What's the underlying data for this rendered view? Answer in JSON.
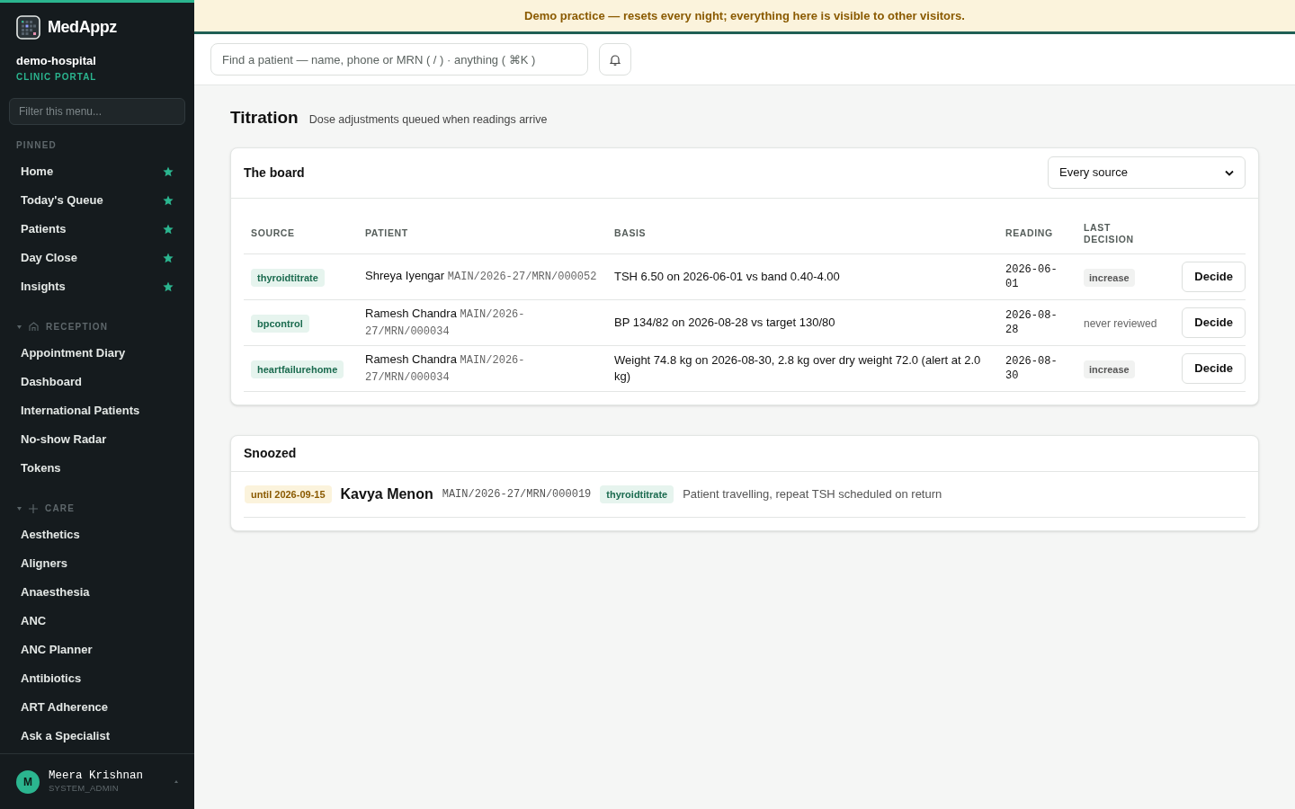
{
  "banner": "Demo practice — resets every night; everything here is visible to other visitors.",
  "sidebar": {
    "brand": "MedAppz",
    "org": "demo-hospital",
    "portal": "CLINIC PORTAL",
    "filter": {
      "placeholder": "Filter this menu..."
    },
    "sections": [
      {
        "label": "PINNED",
        "kind": "plain",
        "items": [
          {
            "label": "Home",
            "pinned": true
          },
          {
            "label": "Today's Queue",
            "pinned": true
          },
          {
            "label": "Patients",
            "pinned": true
          },
          {
            "label": "Day Close",
            "pinned": true
          },
          {
            "label": "Insights",
            "pinned": true
          }
        ]
      },
      {
        "label": "RECEPTION",
        "kind": "reception",
        "expanded": true,
        "items": [
          {
            "label": "Appointment Diary",
            "pinned": false
          },
          {
            "label": "Dashboard",
            "pinned": false
          },
          {
            "label": "International Patients",
            "pinned": false
          },
          {
            "label": "No-show Radar",
            "pinned": false
          },
          {
            "label": "Tokens",
            "pinned": false
          }
        ]
      },
      {
        "label": "CARE",
        "kind": "care",
        "expanded": true,
        "items": [
          {
            "label": "Aesthetics",
            "pinned": false
          },
          {
            "label": "Aligners",
            "pinned": false
          },
          {
            "label": "Anaesthesia",
            "pinned": false
          },
          {
            "label": "ANC",
            "pinned": false
          },
          {
            "label": "ANC Planner",
            "pinned": false
          },
          {
            "label": "Antibiotics",
            "pinned": false
          },
          {
            "label": "ART Adherence",
            "pinned": false
          },
          {
            "label": "Ask a Specialist",
            "pinned": false
          }
        ]
      }
    ],
    "user": {
      "initial": "M",
      "name": "Meera Krishnan",
      "role": "SYSTEM_ADMIN"
    }
  },
  "search": {
    "placeholder": "Find a patient — name, phone or MRN ( / ) · anything ( ⌘K )"
  },
  "page": {
    "title": "Titration",
    "subtitle": "Dose adjustments queued when readings arrive"
  },
  "board": {
    "title": "The board",
    "filter": "Every source",
    "columns": [
      "SOURCE",
      "PATIENT",
      "BASIS",
      "READING",
      "LAST DECISION"
    ],
    "rows": [
      {
        "source": "thyroidtitrate",
        "patient": "Shreya Iyengar",
        "mrn": "MAIN/2026-27/MRN/000052",
        "basis": "TSH 6.50 on 2026-06-01 vs band 0.40-4.00",
        "reading": "2026-06-01",
        "decision": {
          "kind": "badge",
          "text": "increase"
        },
        "action": "Decide"
      },
      {
        "source": "bpcontrol",
        "patient": "Ramesh Chandra",
        "mrn": "MAIN/2026-27/MRN/000034",
        "basis": "BP 134/82 on 2026-08-28 vs target 130/80",
        "reading": "2026-08-28",
        "decision": {
          "kind": "plain",
          "text": "never reviewed"
        },
        "action": "Decide"
      },
      {
        "source": "heartfailurehome",
        "patient": "Ramesh Chandra",
        "mrn": "MAIN/2026-27/MRN/000034",
        "basis": "Weight 74.8 kg on 2026-08-30, 2.8 kg over dry weight 72.0 (alert at 2.0 kg)",
        "reading": "2026-08-30",
        "decision": {
          "kind": "badge",
          "text": "increase"
        },
        "action": "Decide"
      }
    ]
  },
  "snoozed": {
    "title": "Snoozed",
    "items": [
      {
        "until": "until 2026-09-15",
        "patient": "Kavya Menon",
        "mrn": "MAIN/2026-27/MRN/000019",
        "source": "thyroidtitrate",
        "note": "Patient travelling, repeat TSH scheduled on return"
      }
    ]
  }
}
